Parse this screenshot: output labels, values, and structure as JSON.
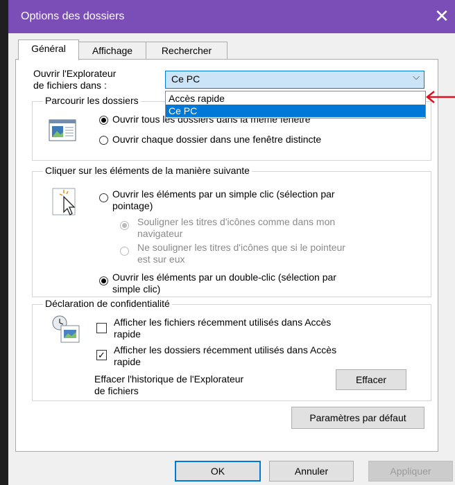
{
  "window": {
    "title": "Options des dossiers",
    "close_glyph": "✕"
  },
  "tabs": [
    {
      "label": "Général",
      "active": true
    },
    {
      "label": "Affichage",
      "active": false
    },
    {
      "label": "Rechercher",
      "active": false
    }
  ],
  "open_in": {
    "label_line1": "Ouvrir l'Explorateur",
    "label_line2": "de fichiers dans :",
    "value": "Ce PC",
    "chevron": "⌵",
    "options": [
      "Accès rapide",
      "Ce PC"
    ],
    "selected_option": "Ce PC"
  },
  "browse_group": {
    "title": "Parcourir les dossiers",
    "option_same_window": "Ouvrir tous les dossiers dans la même fenêtre",
    "option_new_window": "Ouvrir chaque dossier dans une fenêtre distincte"
  },
  "click_group": {
    "title": "Cliquer sur les éléments de la manière suivante",
    "single_click_line1": "Ouvrir les éléments par un simple clic (sélection par",
    "single_click_line2": "pointage)",
    "underline_always_line1": "Souligner les titres d'icônes comme dans mon",
    "underline_always_line2": "navigateur",
    "underline_hover_line1": "Ne souligner les titres d'icônes que si le pointeur",
    "underline_hover_line2": "est sur eux",
    "double_click_line1": "Ouvrir les éléments par un double-clic (sélection par",
    "double_click_line2": "simple clic)"
  },
  "privacy_group": {
    "title": "Déclaration de confidentialité",
    "recent_files_line1": "Afficher les fichiers récemment utilisés dans Accès",
    "recent_files_line2": "rapide",
    "recent_files_checked": false,
    "recent_folders_line1": "Afficher les dossiers récemment utilisés dans Accès",
    "recent_folders_line2": "rapide",
    "recent_folders_checked": true,
    "clear_history_line1": "Effacer l'historique de l'Explorateur",
    "clear_history_line2": "de fichiers",
    "clear_button": "Effacer"
  },
  "defaults_button": "Paramètres par défaut",
  "footer": {
    "ok": "OK",
    "cancel": "Annuler",
    "apply": "Appliquer"
  },
  "colors": {
    "titlebar": "#7a4eb6",
    "selection": "#0078d7",
    "annotation_arrow": "#e0101a"
  },
  "icons": [
    "folder-window-icon",
    "cursor-click-icon",
    "privacy-document-icon",
    "red-arrow-annotation-icon"
  ]
}
